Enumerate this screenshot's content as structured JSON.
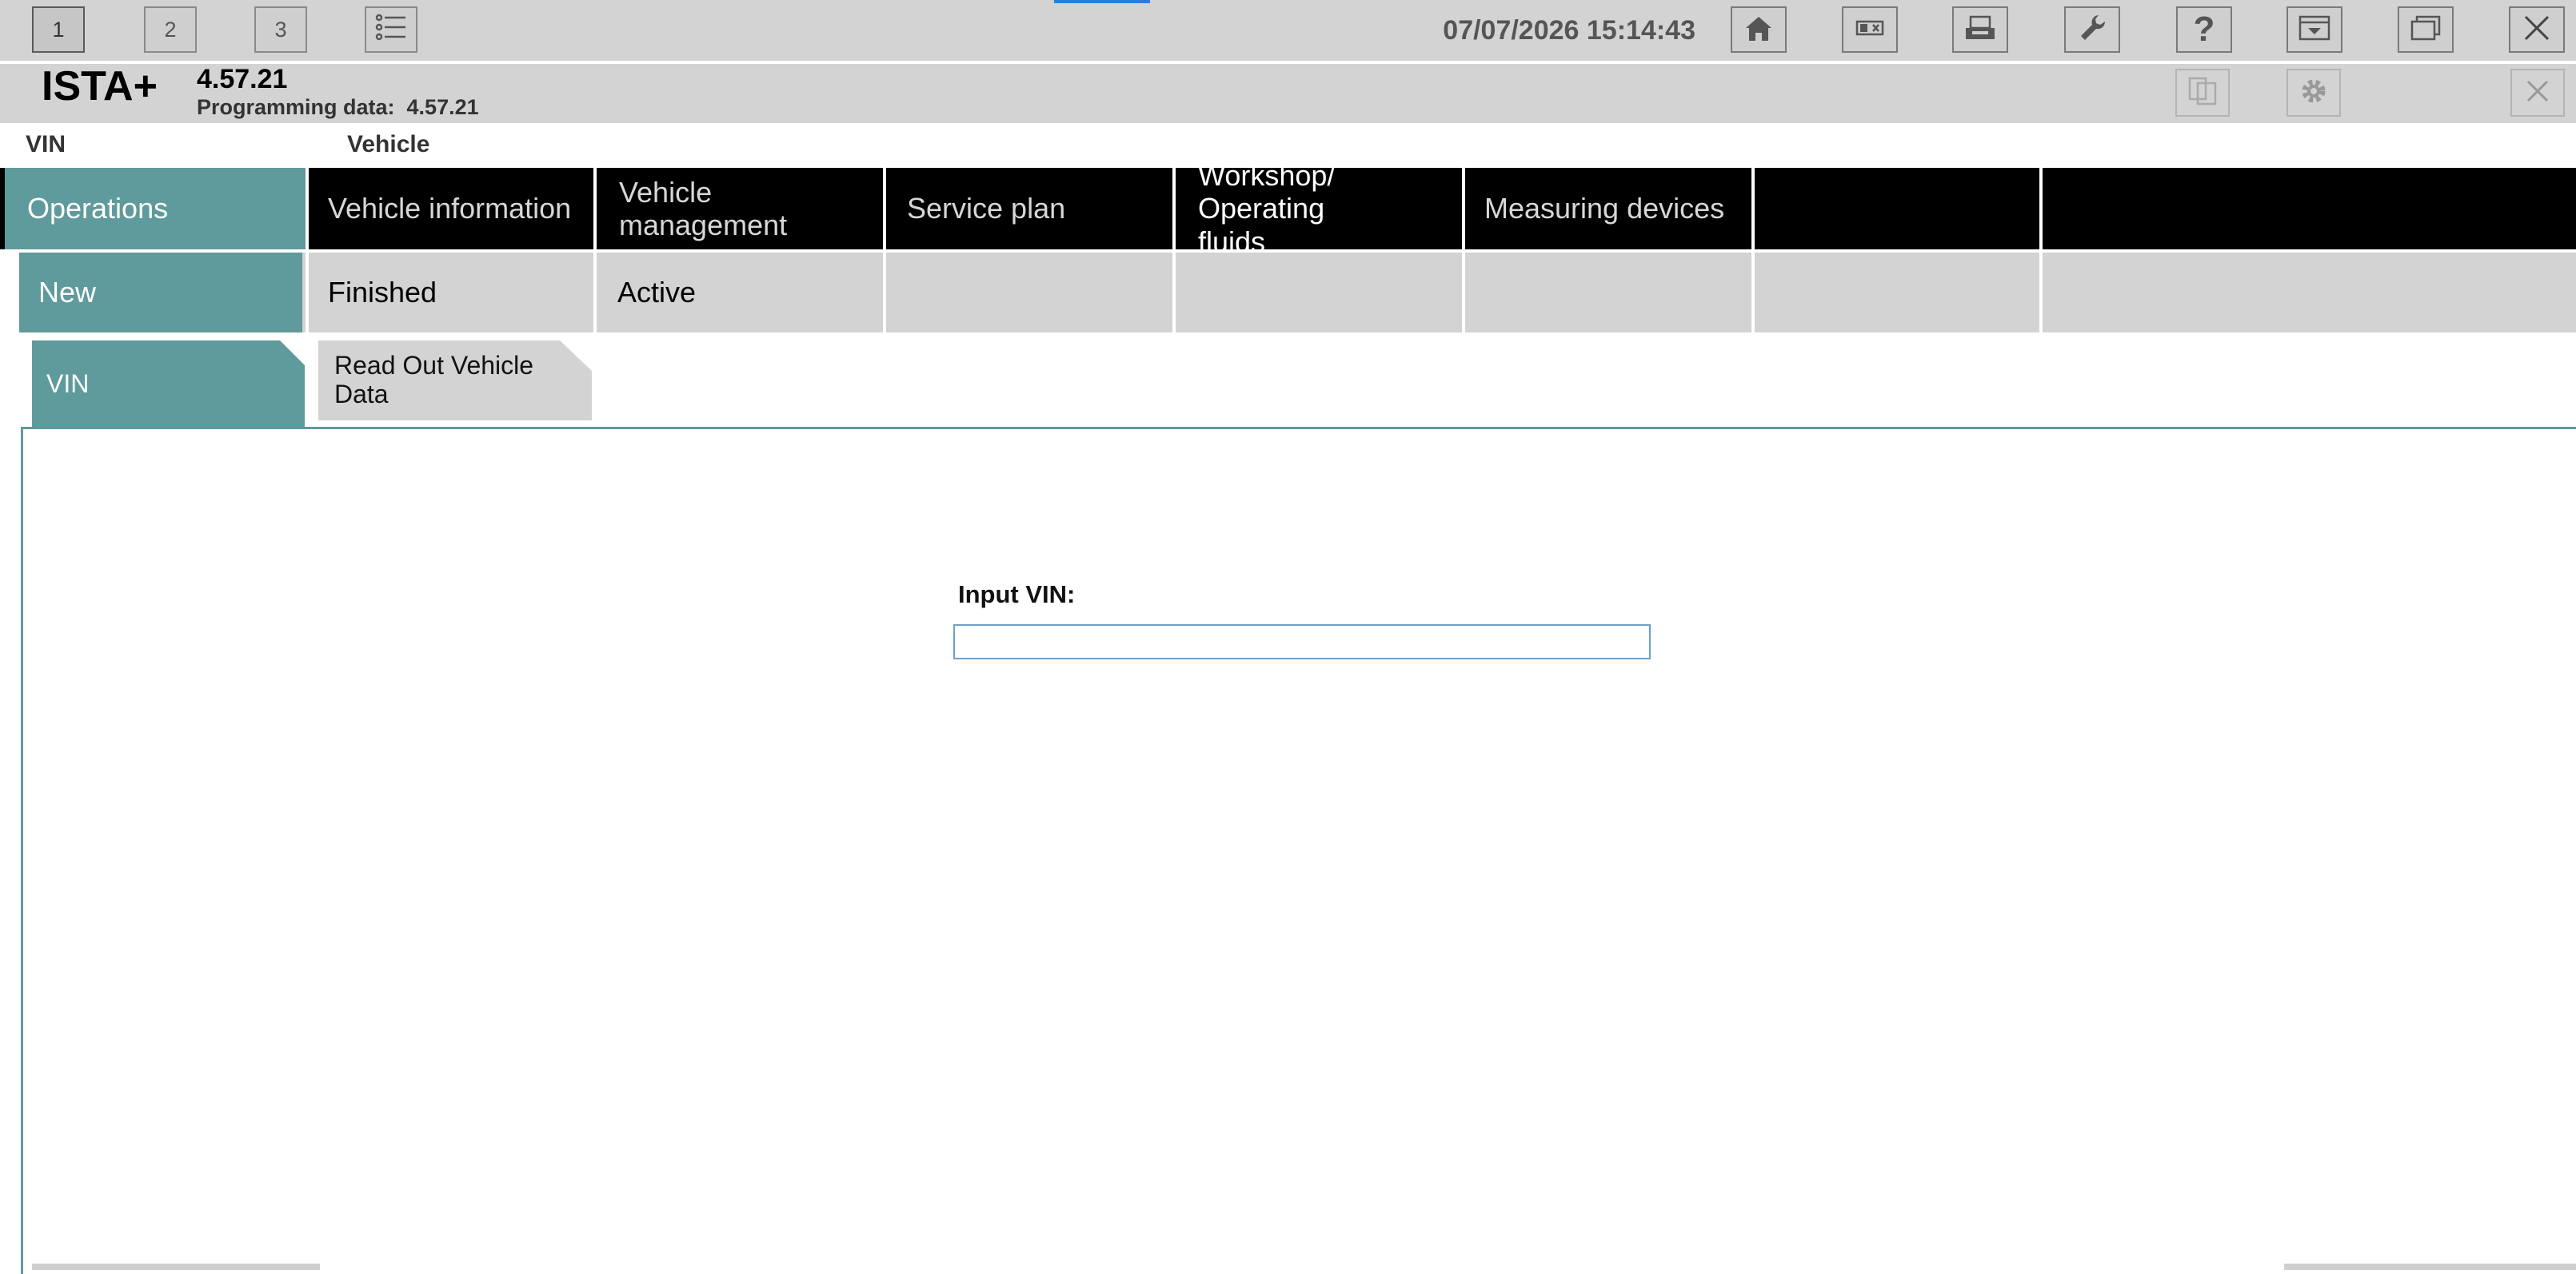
{
  "toolbar": {
    "sessions": [
      "1",
      "2",
      "3"
    ],
    "datetime": "07/07/2026 15:14:43",
    "icons": [
      "list-icon",
      "home-icon",
      "display-toggle-icon",
      "printer-icon",
      "wrench-icon",
      "help-icon",
      "collapse-icon",
      "window-icon",
      "close-icon"
    ],
    "help_glyph": "?"
  },
  "header": {
    "brand": "ISTA+",
    "version": "4.57.21",
    "programming_data": "Programming data:  4.57.21"
  },
  "vehicle_bar": {
    "vin_label": "VIN",
    "vehicle_label": "Vehicle"
  },
  "main_nav": [
    {
      "label": "Operations",
      "active": true
    },
    {
      "label": "Vehicle information",
      "active": false
    },
    {
      "label": "Vehicle management",
      "active": false
    },
    {
      "label": "Service plan",
      "active": false
    },
    {
      "label": "Workshop/ Operating fluids",
      "active": false
    },
    {
      "label": "Measuring devices",
      "active": false
    }
  ],
  "sub_nav": [
    {
      "label": "New",
      "active": true
    },
    {
      "label": "Finished",
      "active": false
    },
    {
      "label": "Active",
      "active": false
    }
  ],
  "tabs": [
    {
      "label": "VIN",
      "active": true
    },
    {
      "label": "Read Out Vehicle Data",
      "active": false
    }
  ],
  "form": {
    "input_label": "Input VIN:",
    "vin_value": ""
  },
  "colors": {
    "accent": "#5f9a9c",
    "toolbar_bg": "#d3d3d3",
    "nav_bg": "#000000",
    "focus": "#2a7fd4"
  }
}
